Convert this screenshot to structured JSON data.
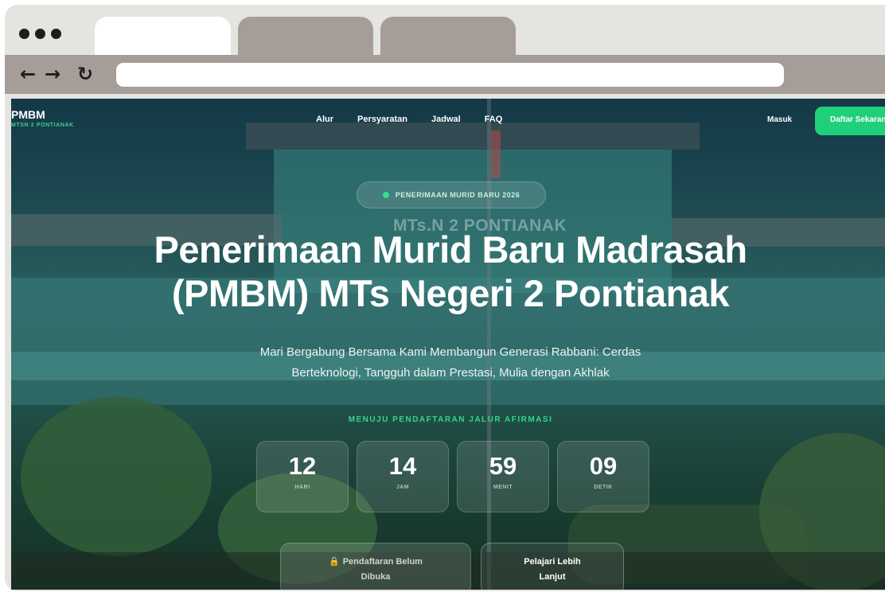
{
  "browser": {
    "tabs": [
      {
        "state": "active"
      },
      {
        "state": "inactive"
      },
      {
        "state": "inactive"
      }
    ],
    "nav_icons": [
      "arrow-left-icon",
      "arrow-right-icon",
      "reload-icon"
    ],
    "url": ""
  },
  "site": {
    "brand": {
      "title": "PMBM",
      "subtitle": "MTSN 2 PONTIANAK"
    },
    "nav_links": [
      "Alur",
      "Persyaratan",
      "Jadwal",
      "FAQ"
    ],
    "login_label": "Masuk",
    "cta_label": "Daftar Sekarang",
    "background_sign": "MTs.N 2 PONTIANAK"
  },
  "hero": {
    "badge": "PENERIMAAN MURID BARU 2026",
    "title_line1": "Penerimaan Murid Baru Madrasah",
    "title_line2": "(PMBM) MTs Negeri 2 Pontianak",
    "subtitle_line1": "Mari Bergabung Bersama Kami Membangun Generasi Rabbani: Cerdas",
    "subtitle_line2": "Berteknologi, Tangguh dalam Prestasi, Mulia dengan Akhlak",
    "countdown_label": "MENUJU PENDAFTARAN JALUR AFIRMASI",
    "countdown": [
      {
        "value": "12",
        "unit": "HARI"
      },
      {
        "value": "14",
        "unit": "JAM"
      },
      {
        "value": "59",
        "unit": "MENIT"
      },
      {
        "value": "09",
        "unit": "DETIK"
      }
    ],
    "registration_button": {
      "line1": "Pendaftaran Belum",
      "line2": "Dibuka",
      "icon": "lock-icon"
    },
    "learn_more_button": {
      "line1": "Pelajari Lebih",
      "line2": "Lanjut"
    }
  },
  "colors": {
    "accent_green": "#1fcf7a",
    "brand_green": "#3fd08a",
    "browser_chrome": "#a69c98",
    "lock_amber": "#f0b33a"
  }
}
